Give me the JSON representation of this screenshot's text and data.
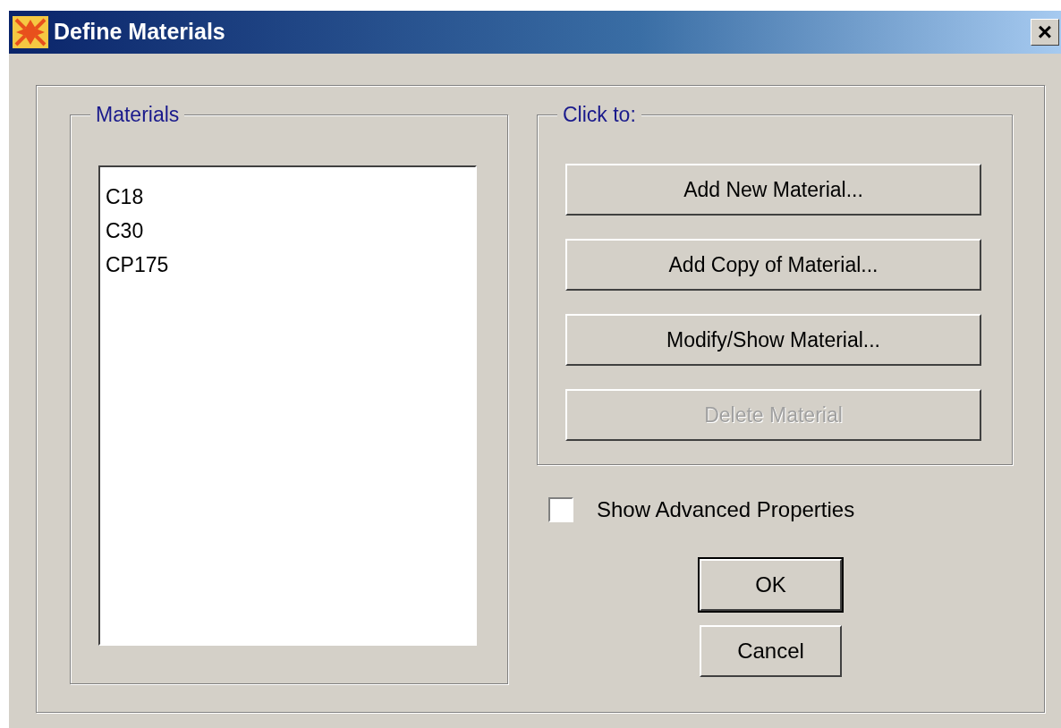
{
  "window": {
    "title": "Define Materials",
    "close": "×"
  },
  "materials_group": {
    "label": "Materials",
    "items": [
      {
        "name": "C18"
      },
      {
        "name": "C30"
      },
      {
        "name": "CP175"
      }
    ]
  },
  "actions_group": {
    "label": "Click to:",
    "buttons": [
      {
        "label": "Add New Material...",
        "disabled": false
      },
      {
        "label": "Add Copy of Material...",
        "disabled": false
      },
      {
        "label": "Modify/Show Material...",
        "disabled": false
      },
      {
        "label": "Delete Material",
        "disabled": true
      }
    ]
  },
  "advanced_checkbox": {
    "label": "Show Advanced Properties",
    "checked": false
  },
  "dialog_buttons": [
    {
      "label": "OK",
      "default": true
    },
    {
      "label": "Cancel",
      "default": false
    }
  ]
}
